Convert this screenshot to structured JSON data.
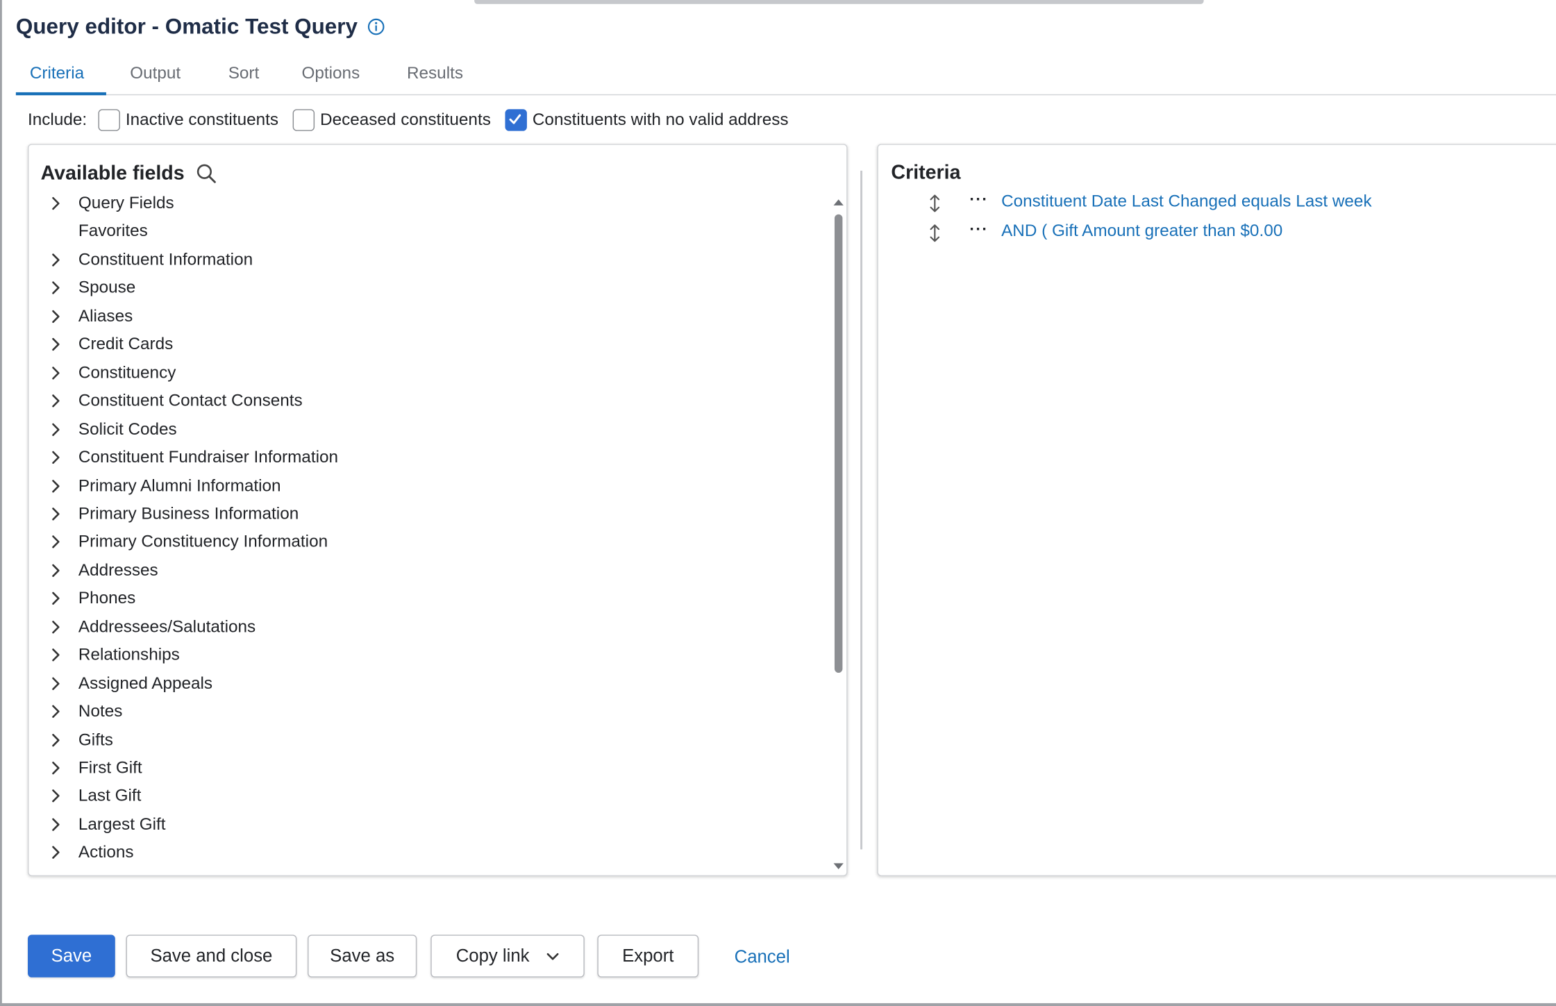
{
  "window": {
    "title": "Query editor - Omatic Test Query",
    "accent_color": "#1870b8",
    "primary_button_color": "#2f6fd3"
  },
  "tabs": [
    {
      "label": "Criteria",
      "active": true
    },
    {
      "label": "Output",
      "active": false
    },
    {
      "label": "Sort",
      "active": false
    },
    {
      "label": "Options",
      "active": false
    },
    {
      "label": "Results",
      "active": false
    }
  ],
  "include": {
    "label": "Include:",
    "options": [
      {
        "label": "Inactive constituents",
        "checked": false
      },
      {
        "label": "Deceased constituents",
        "checked": false
      },
      {
        "label": "Constituents with no valid address",
        "checked": true
      }
    ]
  },
  "available_fields": {
    "heading": "Available fields",
    "items": [
      {
        "label": "Query Fields",
        "expandable": true
      },
      {
        "label": "Favorites",
        "expandable": false
      },
      {
        "label": "Constituent Information",
        "expandable": true
      },
      {
        "label": "Spouse",
        "expandable": true
      },
      {
        "label": "Aliases",
        "expandable": true
      },
      {
        "label": "Credit Cards",
        "expandable": true
      },
      {
        "label": "Constituency",
        "expandable": true
      },
      {
        "label": "Constituent Contact Consents",
        "expandable": true
      },
      {
        "label": "Solicit Codes",
        "expandable": true
      },
      {
        "label": "Constituent Fundraiser Information",
        "expandable": true
      },
      {
        "label": "Primary Alumni Information",
        "expandable": true
      },
      {
        "label": "Primary Business Information",
        "expandable": true
      },
      {
        "label": "Primary Constituency Information",
        "expandable": true
      },
      {
        "label": "Addresses",
        "expandable": true
      },
      {
        "label": "Phones",
        "expandable": true
      },
      {
        "label": "Addressees/Salutations",
        "expandable": true
      },
      {
        "label": "Relationships",
        "expandable": true
      },
      {
        "label": "Assigned Appeals",
        "expandable": true
      },
      {
        "label": "Notes",
        "expandable": true
      },
      {
        "label": "Gifts",
        "expandable": true
      },
      {
        "label": "First Gift",
        "expandable": true
      },
      {
        "label": "Last Gift",
        "expandable": true
      },
      {
        "label": "Largest Gift",
        "expandable": true
      },
      {
        "label": "Actions",
        "expandable": true
      }
    ]
  },
  "criteria": {
    "heading": "Criteria",
    "items": [
      {
        "text": "Constituent Date Last Changed equals Last week"
      },
      {
        "text": "AND ( Gift Amount greater than $0.00"
      }
    ]
  },
  "footer": {
    "save": "Save",
    "save_and_close": "Save and close",
    "save_as": "Save as",
    "copy_link": "Copy link",
    "export": "Export",
    "cancel": "Cancel"
  }
}
